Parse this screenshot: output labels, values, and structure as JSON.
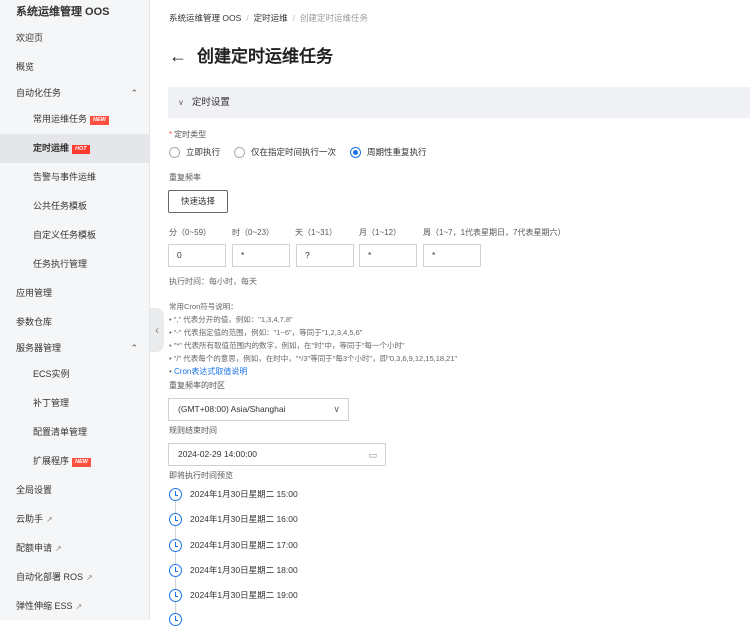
{
  "sidebar": {
    "title": "系统运维管理 OOS",
    "items": [
      {
        "label": "欢迎页"
      },
      {
        "label": "概览"
      },
      {
        "label": "自动化任务",
        "chevron": "⌃"
      },
      {
        "label": "常用运维任务",
        "badge": "NEW"
      },
      {
        "label": "定时运维",
        "badge": "HOT"
      },
      {
        "label": "告警与事件运维"
      },
      {
        "label": "公共任务模板"
      },
      {
        "label": "自定义任务模板"
      },
      {
        "label": "任务执行管理"
      },
      {
        "label": "应用管理"
      },
      {
        "label": "参数仓库"
      },
      {
        "label": "服务器管理",
        "chevron": "⌃"
      },
      {
        "label": "ECS实例"
      },
      {
        "label": "补丁管理"
      },
      {
        "label": "配置清单管理"
      },
      {
        "label": "扩展程序",
        "badge": "NEW"
      },
      {
        "label": "全局设置"
      },
      {
        "label": "云助手"
      },
      {
        "label": "配额申请"
      },
      {
        "label": "自动化部署 ROS"
      },
      {
        "label": "弹性伸缩 ESS"
      }
    ]
  },
  "breadcrumb": [
    "系统运维管理 OOS",
    "定时运维",
    "创建定时运维任务"
  ],
  "page_title": "创建定时运维任务",
  "section_title": "定时设置",
  "form": {
    "schedule_type_label": "定时类型",
    "radios": [
      "立即执行",
      "仅在指定时间执行一次",
      "周期性重复执行"
    ],
    "frequency_label": "重复频率",
    "quick_select": "快速选择",
    "cron_fields": [
      {
        "head": "分（0~59）",
        "value": "0"
      },
      {
        "head": "时（0~23）",
        "value": "*"
      },
      {
        "head": "天（1~31）",
        "value": "?"
      },
      {
        "head": "月（1~12）",
        "value": "*"
      },
      {
        "head": "周（1~7，1代表星期日，7代表星期六）",
        "value": "*"
      }
    ],
    "exec_time": "执行时间：每小时，每天",
    "cron_help_title": "常用Cron符号说明：",
    "cron_help": [
      "• \",\" 代表分开的值，例如：\"1,3,4,7,8\"",
      "• \"-\" 代表指定值的范围，例如：\"1~6\"，等同于\"1,2,3,4,5,6\"",
      "• \"*\" 代表所有取值范围内的数字，例如，在\"时\"中，等同于\"每一个小时\"",
      "• \"/\" 代表每个的意思，例如，在时中，\"*/3\"等同于\"每3个小时\"，即\"0,3,6,9,12,15,18,21\""
    ],
    "cron_link": "Cron表达式取值说明",
    "timezone_label": "重复频率的时区",
    "timezone_value": "(GMT+08:00) Asia/Shanghai",
    "end_time_label": "规则结束时间",
    "end_time_value": "2024-02-29 14:00:00",
    "preview_label": "即将执行时间预览",
    "preview": [
      "2024年1月30日星期二 15:00",
      "2024年1月30日星期二 16:00",
      "2024年1月30日星期二 17:00",
      "2024年1月30日星期二 18:00",
      "2024年1月30日星期二 19:00"
    ]
  },
  "colors": {
    "accent": "#1a73e8",
    "badge": "#ff5040",
    "sidebar_bg": "#f5f6f7",
    "section_bg": "#eff1f5"
  }
}
